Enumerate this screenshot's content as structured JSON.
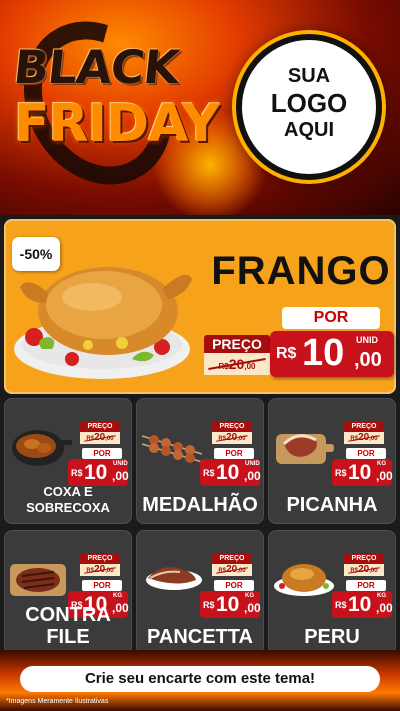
{
  "header": {
    "title_line1": "BLACK",
    "title_line2": "FRIDAY",
    "logo": {
      "line1": "SUA",
      "line2": "LOGO",
      "line3": "AQUI"
    }
  },
  "hero": {
    "discount": "-50%",
    "product": "FRANGO",
    "preco_label": "PREÇO",
    "old_currency": "R$",
    "old_int": "20",
    "old_dec": ",00",
    "por_label": "POR",
    "currency": "R$",
    "price_int": "10",
    "price_dec": ",00",
    "unit": "UNID"
  },
  "products": [
    {
      "name_line1": "COXA E",
      "name_line2": "SOBRECOXA",
      "preco_label": "PREÇO",
      "old_currency": "R$",
      "old_int": "20",
      "old_dec": ",00",
      "por_label": "POR",
      "currency": "R$",
      "price_int": "10",
      "price_dec": ",00",
      "unit": "UNID"
    },
    {
      "name": "MEDALHÃO",
      "preco_label": "PREÇO",
      "old_currency": "R$",
      "old_int": "20",
      "old_dec": ",00",
      "por_label": "POR",
      "currency": "R$",
      "price_int": "10",
      "price_dec": ",00",
      "unit": "UNID"
    },
    {
      "name": "PICANHA",
      "preco_label": "PREÇO",
      "old_currency": "R$",
      "old_int": "20",
      "old_dec": ",00",
      "por_label": "POR",
      "currency": "R$",
      "price_int": "10",
      "price_dec": ",00",
      "unit": "KG"
    },
    {
      "name": "CONTRA FILE",
      "preco_label": "PREÇO",
      "old_currency": "R$",
      "old_int": "20",
      "old_dec": ",00",
      "por_label": "POR",
      "currency": "R$",
      "price_int": "10",
      "price_dec": ",00",
      "unit": "KG"
    },
    {
      "name": "PANCETTA",
      "preco_label": "PREÇO",
      "old_currency": "R$",
      "old_int": "20",
      "old_dec": ",00",
      "por_label": "POR",
      "currency": "R$",
      "price_int": "10",
      "price_dec": ",00",
      "unit": "KG"
    },
    {
      "name": "PERU",
      "preco_label": "PREÇO",
      "old_currency": "R$",
      "old_int": "20",
      "old_dec": ",00",
      "por_label": "POR",
      "currency": "R$",
      "price_int": "10",
      "price_dec": ",00",
      "unit": "KG"
    }
  ],
  "cta": "Crie seu encarte com este tema!",
  "disclaimer": "*Imagens Meramente Ilustrativas",
  "colors": {
    "hero_bg": "#f7a21b",
    "price_red": "#c8121b",
    "card_bg": "#3b3b3b",
    "accent_orange": "#ff8c00"
  }
}
